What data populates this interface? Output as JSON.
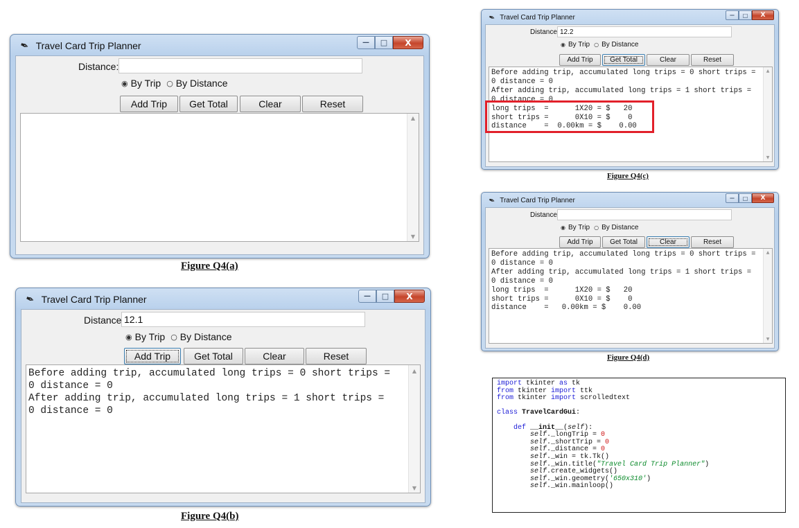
{
  "app_title": "Travel Card Trip Planner",
  "labels": {
    "distance": "Distance:",
    "by_trip": "By Trip",
    "by_distance": "By Distance"
  },
  "buttons": {
    "add_trip": "Add Trip",
    "get_total": "Get Total",
    "clear": "Clear",
    "reset": "Reset"
  },
  "window_controls": {
    "minimize": "—",
    "maximize": "□",
    "close": "X"
  },
  "figures": {
    "a": {
      "caption": "Figure Q4(a)",
      "distance_value": "",
      "output_lines": []
    },
    "b": {
      "caption": "Figure Q4(b)",
      "distance_value": "12.1",
      "output_lines": [
        "Before adding trip, accumulated long trips = 0 short trips =",
        "0 distance = 0",
        "After adding trip, accumulated long trips = 1 short trips =",
        "0 distance = 0"
      ]
    },
    "c": {
      "caption": "Figure Q4(c)",
      "distance_value": "12.2",
      "output_lines": [
        "Before adding trip, accumulated long trips = 0 short trips =",
        "0 distance = 0",
        "After adding trip, accumulated long trips = 1 short trips =",
        "0 distance = 0",
        "long trips  =      1X20 = $   20",
        "short trips =      0X10 = $    0",
        "distance    =  0.00km = $    0.00"
      ]
    },
    "d": {
      "caption": "Figure Q4(d)",
      "distance_value": "",
      "output_lines": [
        "Before adding trip, accumulated long trips = 0 short trips =",
        "0 distance = 0",
        "After adding trip, accumulated long trips = 1 short trips =",
        "0 distance = 0",
        "long trips  =      1X20 = $   20",
        "short trips =      0X10 = $    0",
        "distance    =   0.00km = $    0.00"
      ]
    }
  },
  "code": {
    "line1_kw1": "import",
    "line1_rest": " tkinter ",
    "line1_kw2": "as",
    "line1_end": " tk",
    "line2_kw1": "from",
    "line2_mid": " tkinter ",
    "line2_kw2": "import",
    "line2_end": " ttk",
    "line3_kw1": "from",
    "line3_mid": " tkinter ",
    "line3_kw2": "import",
    "line3_end": " scrolledtext",
    "line5_kw": "class",
    "line5_name": " TravelCardGui",
    "line5_colon": ":",
    "line7_kw": "def",
    "line7_name": " __init__",
    "line7_open": "(",
    "line7_self": "self",
    "line7_close": "):",
    "self_word": "self",
    "l8_attr": "._longTrip = ",
    "l8_num": "0",
    "l9_attr": "._shortTrip = ",
    "l9_num": "0",
    "l10_attr": "._distance = ",
    "l10_num": "0",
    "l11_attr": "._win = tk.Tk()",
    "l12_attr": "._win.title(",
    "l12_str": "\"Travel Card Trip Planner\"",
    "l12_end": ")",
    "l13_attr": ".create_widgets()",
    "l14_attr": "._win.geometry(",
    "l14_str": "'650x310'",
    "l14_end": ")",
    "l15_attr": "._win.mainloop()"
  }
}
